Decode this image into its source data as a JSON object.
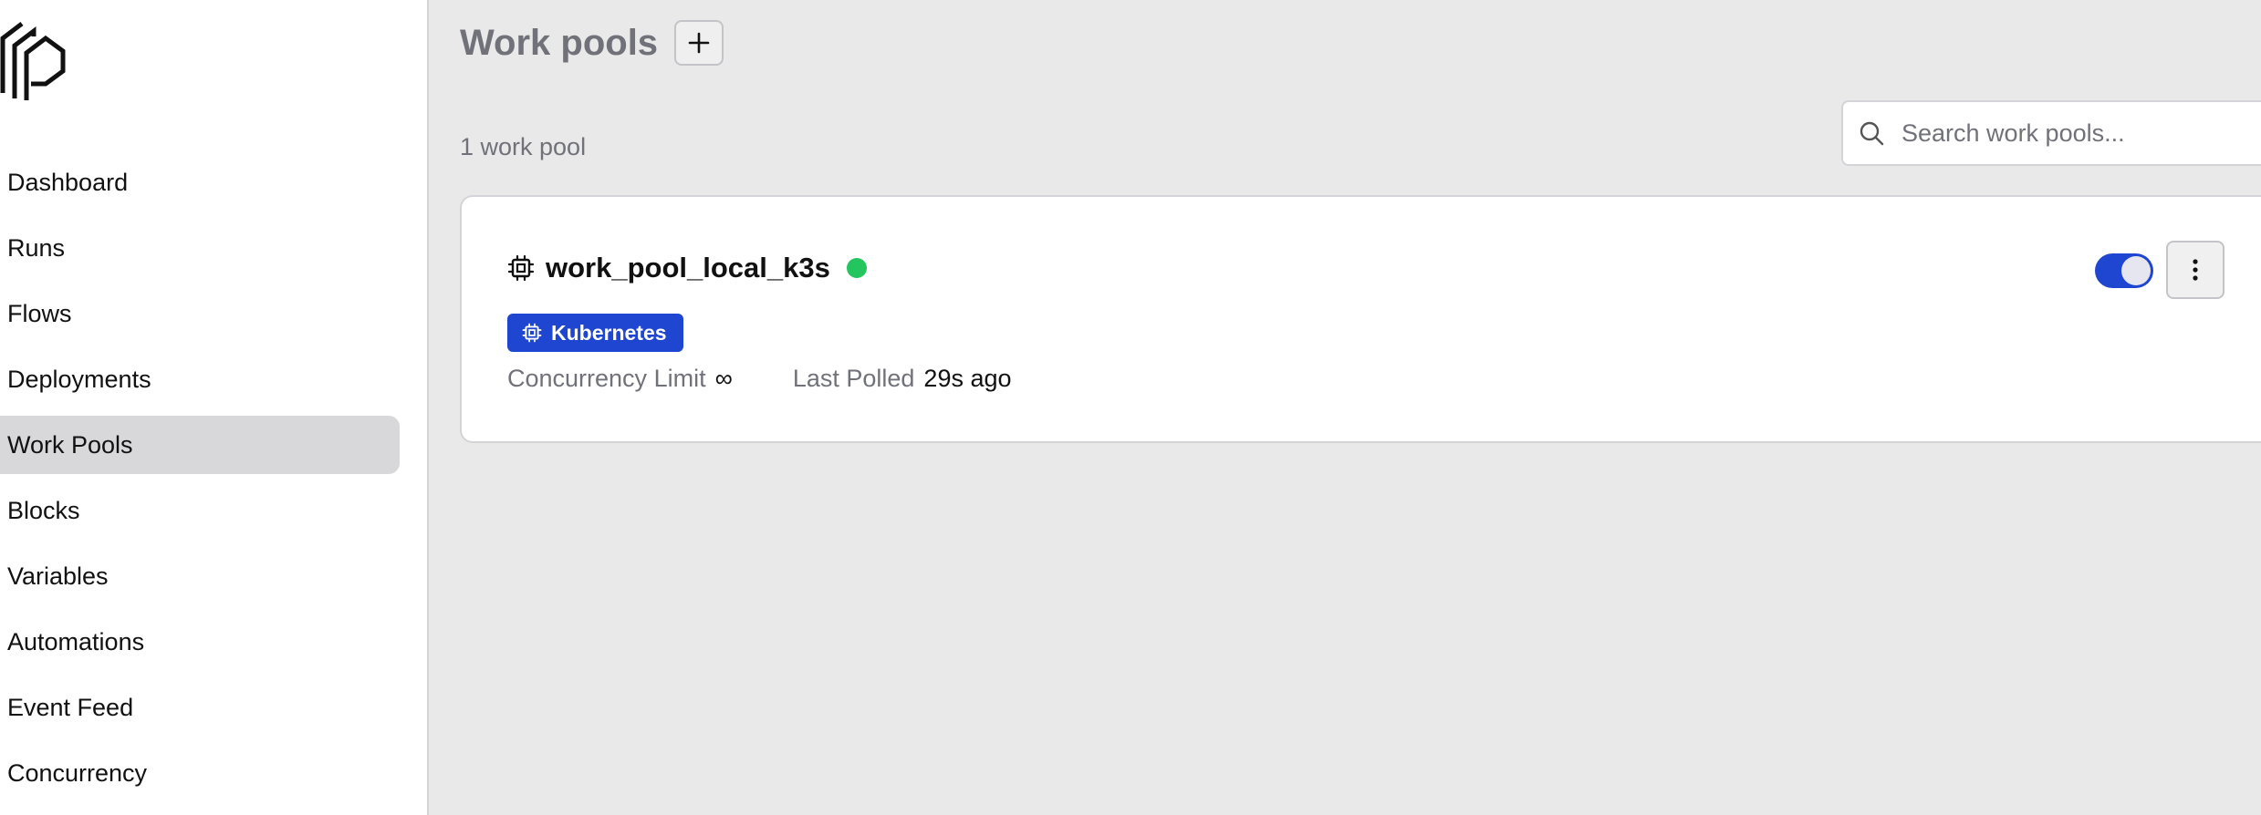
{
  "sidebar": {
    "logo_icon": "prefect-logo-icon",
    "items": [
      {
        "label": "Dashboard",
        "active": false
      },
      {
        "label": "Runs",
        "active": false
      },
      {
        "label": "Flows",
        "active": false
      },
      {
        "label": "Deployments",
        "active": false
      },
      {
        "label": "Work Pools",
        "active": true
      },
      {
        "label": "Blocks",
        "active": false
      },
      {
        "label": "Variables",
        "active": false
      },
      {
        "label": "Automations",
        "active": false
      },
      {
        "label": "Event Feed",
        "active": false
      },
      {
        "label": "Concurrency",
        "active": false
      }
    ]
  },
  "header": {
    "title": "Work pools",
    "add_icon": "plus-icon"
  },
  "toolbar": {
    "count_text": "1 work pool",
    "search": {
      "placeholder": "Search work pools...",
      "value": "",
      "icon": "search-icon"
    }
  },
  "pool": {
    "name": "work_pool_local_k3s",
    "icon": "cpu-chip-icon",
    "status": "ready",
    "status_color": "#22c55e",
    "type_label": "Kubernetes",
    "type_color": "#1f46d1",
    "concurrency_label": "Concurrency Limit",
    "concurrency_value": "∞",
    "last_polled_label": "Last Polled",
    "last_polled_value": "29s ago",
    "enabled": true,
    "menu_icon": "more-vertical-icon"
  },
  "colors": {
    "accent": "#1f46d1",
    "background": "#e9e9e9",
    "muted_text": "#71717a"
  }
}
